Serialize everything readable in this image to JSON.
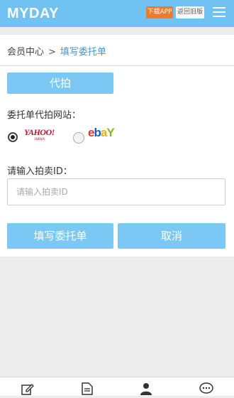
{
  "header": {
    "logo": "MYDAY",
    "download_button": "下载APP",
    "old_version_button": "返回旧版",
    "menu_icon": "hamburger-menu-icon",
    "bar_color": "#6fc2f2"
  },
  "breadcrumb": {
    "home": "会员中心",
    "separator": ">",
    "current": "填写委托单"
  },
  "form": {
    "tab_label": "代拍",
    "site_label": "委托单代拍网站：",
    "sites": [
      {
        "name": "yahoo",
        "logo": "YAHOO!",
        "logo_sub": "JAPAN",
        "selected": true
      },
      {
        "name": "ebay",
        "logo": "ebay",
        "selected": false
      }
    ],
    "id_label": "请输入拍卖ID：",
    "id_placeholder": "请输入拍卖ID",
    "id_value": "",
    "submit_label": "填写委托单",
    "cancel_label": "取消",
    "button_color": "#7cc8f4"
  },
  "footer": {
    "icons": [
      "edit-icon",
      "document-icon",
      "user-icon",
      "chat-icon"
    ]
  }
}
